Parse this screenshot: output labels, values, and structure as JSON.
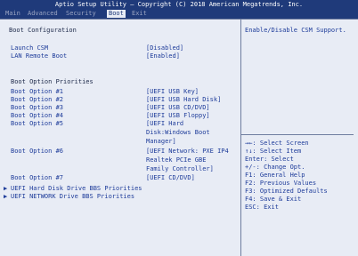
{
  "header": {
    "title": "Aptio Setup Utility – Copyright (C) 2018 American Megatrends, Inc.",
    "tabs": [
      "Main",
      "Advanced",
      "Security",
      "Boot",
      "Exit"
    ],
    "active_tab": "Boot"
  },
  "section_title": "Boot Configuration",
  "settings": {
    "launch_csm": {
      "label": "Launch CSM",
      "value": "[Disabled]"
    },
    "lan_remote_boot": {
      "label": "LAN Remote Boot",
      "value": "[Enabled]"
    }
  },
  "priorities_title": "Boot Option Priorities",
  "boot_options": [
    {
      "label": "Boot Option #1",
      "value": [
        "[UEFI USB Key]"
      ]
    },
    {
      "label": "Boot Option #2",
      "value": [
        "[UEFI USB Hard Disk]"
      ]
    },
    {
      "label": "Boot Option #3",
      "value": [
        "[UEFI USB CD/DVD]"
      ]
    },
    {
      "label": "Boot Option #4",
      "value": [
        "[UEFI USB Floppy]"
      ]
    },
    {
      "label": "Boot Option #5",
      "value": [
        "[UEFI Hard",
        "Disk:Windows Boot",
        "Manager]"
      ]
    },
    {
      "label": "Boot Option #6",
      "value": [
        "[UEFI Network: PXE IP4",
        "Realtek PCIe GBE",
        "Family Controller]"
      ]
    },
    {
      "label": "Boot Option #7",
      "value": [
        "[UEFI CD/DVD]"
      ]
    }
  ],
  "submenus": [
    {
      "label": "UEFI Hard Disk Drive BBS Priorities"
    },
    {
      "label": "UEFI NETWORK Drive BBS Priorities"
    }
  ],
  "help": {
    "description": "Enable/Disable CSM Support.",
    "keys": [
      "→←: Select Screen",
      "↑↓: Select Item",
      "Enter: Select",
      "+/-: Change Opt.",
      "F1: General Help",
      "F2: Previous Values",
      "F3: Optimized Defaults",
      "F4: Save & Exit",
      "ESC: Exit"
    ]
  },
  "colors": {
    "header_bg": "#1f3a7a",
    "panel_bg": "#e8ecf5",
    "text_blue": "#1e3c9a",
    "text_dark": "#1e2a4a"
  }
}
